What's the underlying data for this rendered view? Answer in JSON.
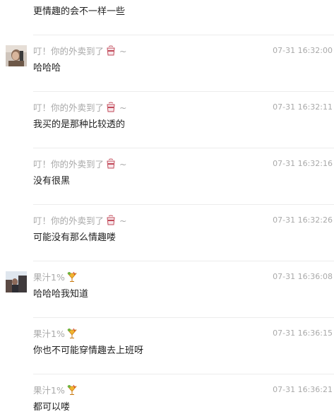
{
  "colors": {
    "sender": "#a9a9a9",
    "time": "#a9a9a9",
    "text": "#222222",
    "divider": "#ececec"
  },
  "messages": [
    {
      "text": "更情趣的会不一样一些"
    },
    {
      "sender": "叮！你的外卖到了",
      "sender_emoji": "takeout-box-icon",
      "sender_suffix": "~",
      "time": "07-31 16:32:00",
      "text": "哈哈哈",
      "avatar": "avatar-photo-a"
    },
    {
      "sender": "叮！你的外卖到了",
      "sender_emoji": "takeout-box-icon",
      "sender_suffix": "~",
      "time": "07-31 16:32:11",
      "text": "我买的是那种比较透的"
    },
    {
      "sender": "叮！你的外卖到了",
      "sender_emoji": "takeout-box-icon",
      "sender_suffix": "~",
      "time": "07-31 16:32:16",
      "text": "没有很黑"
    },
    {
      "sender": "叮！你的外卖到了",
      "sender_emoji": "takeout-box-icon",
      "sender_suffix": "~",
      "time": "07-31 16:32:26",
      "text": "可能没有那么情趣喽"
    },
    {
      "sender": "果汁1%",
      "sender_emoji": "tropical-drink-icon",
      "time": "07-31 16:36:08",
      "text": "哈哈哈我知道",
      "avatar": "avatar-photo-b"
    },
    {
      "sender": "果汁1%",
      "sender_emoji": "tropical-drink-icon",
      "time": "07-31 16:36:15",
      "text": "你也不可能穿情趣去上班呀"
    },
    {
      "sender": "果汁1%",
      "sender_emoji": "tropical-drink-icon",
      "time": "07-31 16:36:21",
      "text": "都可以喽"
    }
  ]
}
